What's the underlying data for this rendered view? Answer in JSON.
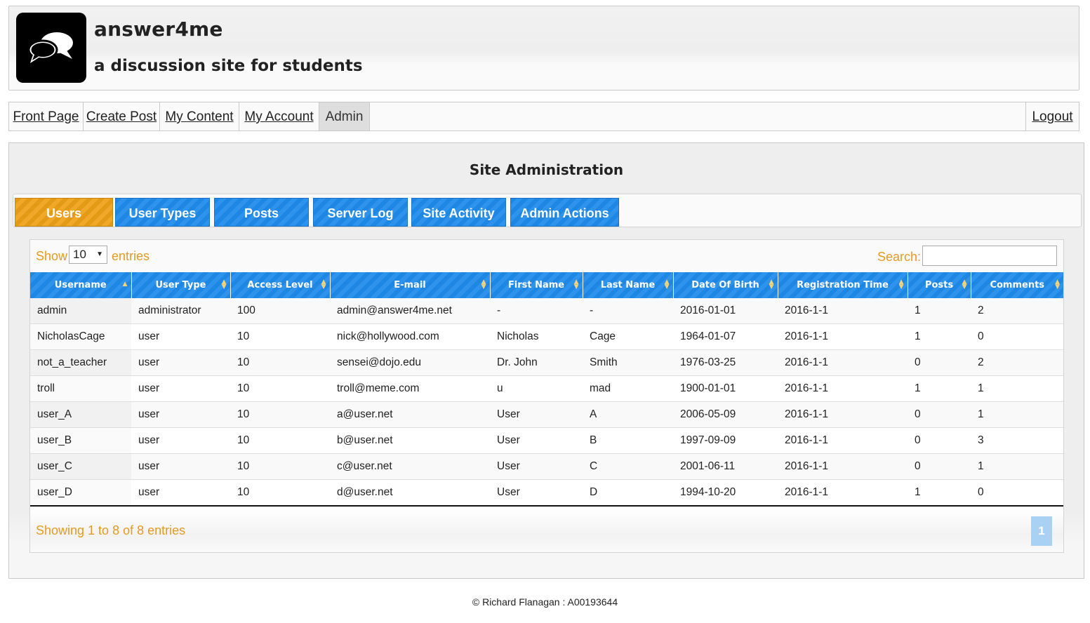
{
  "site": {
    "title": "answer4me",
    "tagline": "a discussion site for students",
    "logo_icon": "chat-bubbles-icon"
  },
  "nav": {
    "items": [
      {
        "label": "Front Page"
      },
      {
        "label": "Create Post"
      },
      {
        "label": "My Content"
      },
      {
        "label": "My Account"
      },
      {
        "label": "Admin",
        "active": true
      }
    ],
    "logout_label": "Logout"
  },
  "admin": {
    "title": "Site Administration",
    "tabs": [
      {
        "label": "Users",
        "active": true
      },
      {
        "label": "User Types"
      },
      {
        "label": "Posts"
      },
      {
        "label": "Server Log"
      },
      {
        "label": "Site Activity"
      },
      {
        "label": "Admin Actions"
      }
    ]
  },
  "table": {
    "show_label": "Show",
    "page_length": "10",
    "entries_label": "entries",
    "search_label": "Search:",
    "search_value": "",
    "columns": [
      "Username",
      "User Type",
      "Access Level",
      "E-mail",
      "First Name",
      "Last Name",
      "Date Of Birth",
      "Registration Time",
      "Posts",
      "Comments"
    ],
    "sorted_column": "Username",
    "rows": [
      [
        "admin",
        "administrator",
        "100",
        "admin@answer4me.net",
        "-",
        "-",
        "2016-01-01",
        "2016-1-1",
        "1",
        "2"
      ],
      [
        "NicholasCage",
        "user",
        "10",
        "nick@hollywood.com",
        "Nicholas",
        "Cage",
        "1964-01-07",
        "2016-1-1",
        "1",
        "0"
      ],
      [
        "not_a_teacher",
        "user",
        "10",
        "sensei@dojo.edu",
        "Dr. John",
        "Smith",
        "1976-03-25",
        "2016-1-1",
        "0",
        "2"
      ],
      [
        "troll",
        "user",
        "10",
        "troll@meme.com",
        "u",
        "mad",
        "1900-01-01",
        "2016-1-1",
        "1",
        "1"
      ],
      [
        "user_A",
        "user",
        "10",
        "a@user.net",
        "User",
        "A",
        "2006-05-09",
        "2016-1-1",
        "0",
        "1"
      ],
      [
        "user_B",
        "user",
        "10",
        "b@user.net",
        "User",
        "B",
        "1997-09-09",
        "2016-1-1",
        "0",
        "3"
      ],
      [
        "user_C",
        "user",
        "10",
        "c@user.net",
        "User",
        "C",
        "2001-06-11",
        "2016-1-1",
        "0",
        "1"
      ],
      [
        "user_D",
        "user",
        "10",
        "d@user.net",
        "User",
        "D",
        "1994-10-20",
        "2016-1-1",
        "1",
        "0"
      ]
    ],
    "info": "Showing 1 to 8 of 8 entries",
    "current_page": "1"
  },
  "footer": {
    "text": "© Richard Flanagan : A00193644"
  },
  "colors": {
    "tab_blue": "#1e86e3",
    "tab_orange": "#e39a17",
    "label_orange": "#e39b22",
    "page_button": "#a9d1f3"
  }
}
